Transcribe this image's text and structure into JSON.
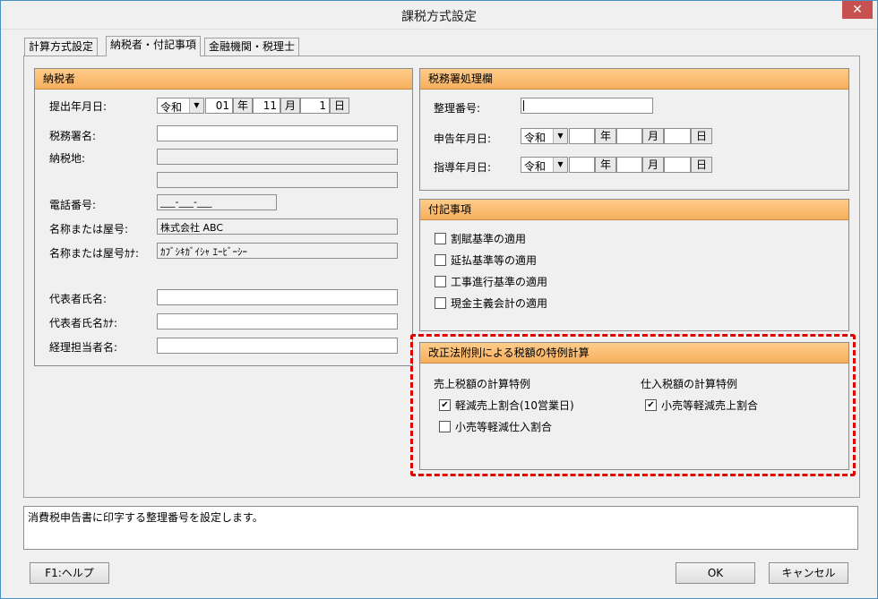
{
  "window": {
    "title": "課税方式設定",
    "close_glyph": "✕"
  },
  "tabs": [
    {
      "label": "計算方式設定"
    },
    {
      "label": "納税者・付記事項"
    },
    {
      "label": "金融機関・税理士"
    }
  ],
  "taxpayer": {
    "header": "納税者",
    "submit_date_label": "提出年月日:",
    "era": "令和",
    "year": "01",
    "year_unit": "年",
    "month": "11",
    "month_unit": "月",
    "day": "1",
    "day_unit": "日",
    "tax_office_label": "税務署名:",
    "address_label": "納税地:",
    "phone_label": "電話番号:",
    "phone_value": "___-___-___",
    "name_label": "名称または屋号:",
    "name_value": "株式会社 ABC",
    "name_kana_label": "名称または屋号ｶﾅ:",
    "name_kana_value": "ｶﾌﾞｼｷｶﾞｲｼｬ ｴｰﾋﾞｰｼｰ",
    "rep_name_label": "代表者氏名:",
    "rep_kana_label": "代表者氏名ｶﾅ:",
    "accountant_label": "経理担当者名:"
  },
  "tax_office_section": {
    "header": "税務署処理欄",
    "ref_no_label": "整理番号:",
    "report_date_label": "申告年月日:",
    "guidance_date_label": "指導年月日:",
    "era": "令和",
    "year_unit": "年",
    "month_unit": "月",
    "day_unit": "日"
  },
  "notes": {
    "header": "付記事項",
    "items": [
      {
        "label": "割賦基準の適用",
        "checked": false
      },
      {
        "label": "延払基準等の適用",
        "checked": false
      },
      {
        "label": "工事進行基準の適用",
        "checked": false
      },
      {
        "label": "現金主義会計の適用",
        "checked": false
      }
    ]
  },
  "special_calc": {
    "header": "改正法附則による税額の特例計算",
    "sales_title": "売上税額の計算特例",
    "purchase_title": "仕入税額の計算特例",
    "sales_items": [
      {
        "label": "軽減売上割合(10営業日)",
        "checked": true
      },
      {
        "label": "小売等軽減仕入割合",
        "checked": false
      }
    ],
    "purchase_items": [
      {
        "label": "小売等軽減売上割合",
        "checked": true
      }
    ],
    "check_glyph": "✔"
  },
  "status": {
    "message": "消費税申告書に印字する整理番号を設定します。"
  },
  "buttons": {
    "help": "F1:ヘルプ",
    "ok": "OK",
    "cancel": "キャンセル"
  },
  "colors": {
    "header_bg": "#f6b05e",
    "highlight": "#e00000",
    "close_bg": "#c75050"
  }
}
